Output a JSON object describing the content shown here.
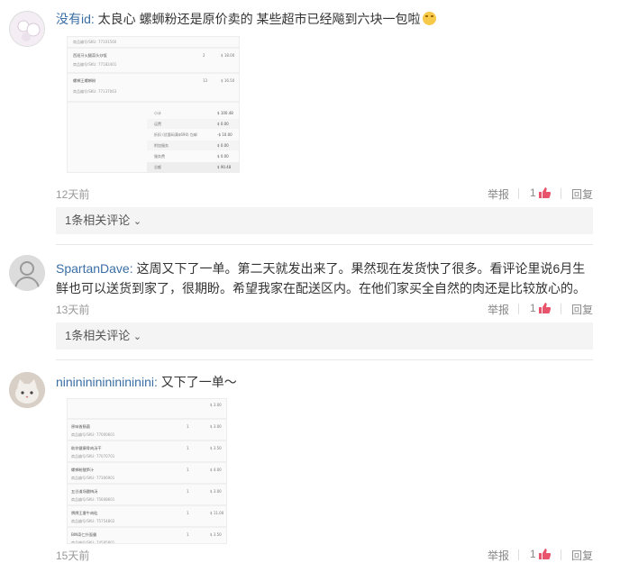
{
  "comments": [
    {
      "user": "没有id:",
      "text": " 太良心 螺蛳粉还是原价卖的 某些超市已经飚到六块一包啦",
      "time": "12天前",
      "report": "举报",
      "likes": "1",
      "reply": "回复",
      "related": "1条相关评论",
      "attachment": {
        "rows": [
          {
            "label": "",
            "sku": "商品编号/SKU: 77101560",
            "qty": "",
            "price": ""
          },
          {
            "label": "西班牙火腿蒜头炒饭",
            "sku": "商品编号/SKU: 77182401",
            "qty": "2",
            "price": "$ 18.00"
          },
          {
            "label": "螺蛳王螺蛳粉",
            "sku": "商品编号/SKU: 77137063",
            "qty": "13",
            "price": "$ 16.50"
          }
        ],
        "summary": [
          {
            "label": "小计",
            "value": "$ 100.48"
          },
          {
            "label": "运费",
            "value": "$ 0.00"
          },
          {
            "label": "折扣 (优惠码满$690) 包邮",
            "value": "-$ 10.00"
          },
          {
            "label": "附加服务",
            "value": "$ 0.00"
          },
          {
            "label": "服务费",
            "value": "$ 0.00"
          },
          {
            "label": "总额",
            "value": "$ 90.48"
          }
        ]
      }
    },
    {
      "user": "SpartanDave:",
      "text": " 这周又下了一单。第二天就发出来了。果然现在发货快了很多。看评论里说6月生鲜也可以送货到家了，很期盼。希望我家在配送区内。在他们家买全自然的肉还是比较放心的。",
      "time": "13天前",
      "report": "举报",
      "likes": "1",
      "reply": "回复",
      "related": "1条相关评论"
    },
    {
      "user": "nininininininininini:",
      "text": " 又下了一单～",
      "time": "15天前",
      "report": "举报",
      "likes": "1",
      "reply": "回复",
      "attachment": {
        "rows": [
          {
            "label": "",
            "sku": "",
            "qty": "",
            "price": "$ 3.00"
          },
          {
            "label": "原味香肠菌",
            "sku": "商品编号/SKU: 77000601",
            "qty": "1",
            "price": "$ 3.00"
          },
          {
            "label": "助你健康骨肉汤干",
            "sku": "商品编号/SKU: 77070701",
            "qty": "1",
            "price": "$ 3.50"
          },
          {
            "label": "螺蛳粉酸笋汁",
            "sku": "商品编号/SKU: 77306901",
            "qty": "1",
            "price": "$ 4.00"
          },
          {
            "label": "五谷道场酸梅汤",
            "sku": "商品编号/SKU: 75608601",
            "qty": "1",
            "price": "$ 3.00"
          },
          {
            "label": "牌牌王番牛肉粒",
            "sku": "商品编号/SKU: 75754802",
            "qty": "1",
            "price": "$ 11.00"
          },
          {
            "label": "BIN奇仁扑面霸",
            "sku": "商品编号/SKU: 74595801",
            "qty": "1",
            "price": "$ 3.50"
          }
        ]
      }
    }
  ],
  "colors": {
    "username": "#3a6ea5",
    "like_icon": "#e8546b",
    "meta": "#999999"
  },
  "icons": {
    "like": "thumbs-up-icon",
    "expand": "chevron-down-icon"
  },
  "chevron": "⌄"
}
